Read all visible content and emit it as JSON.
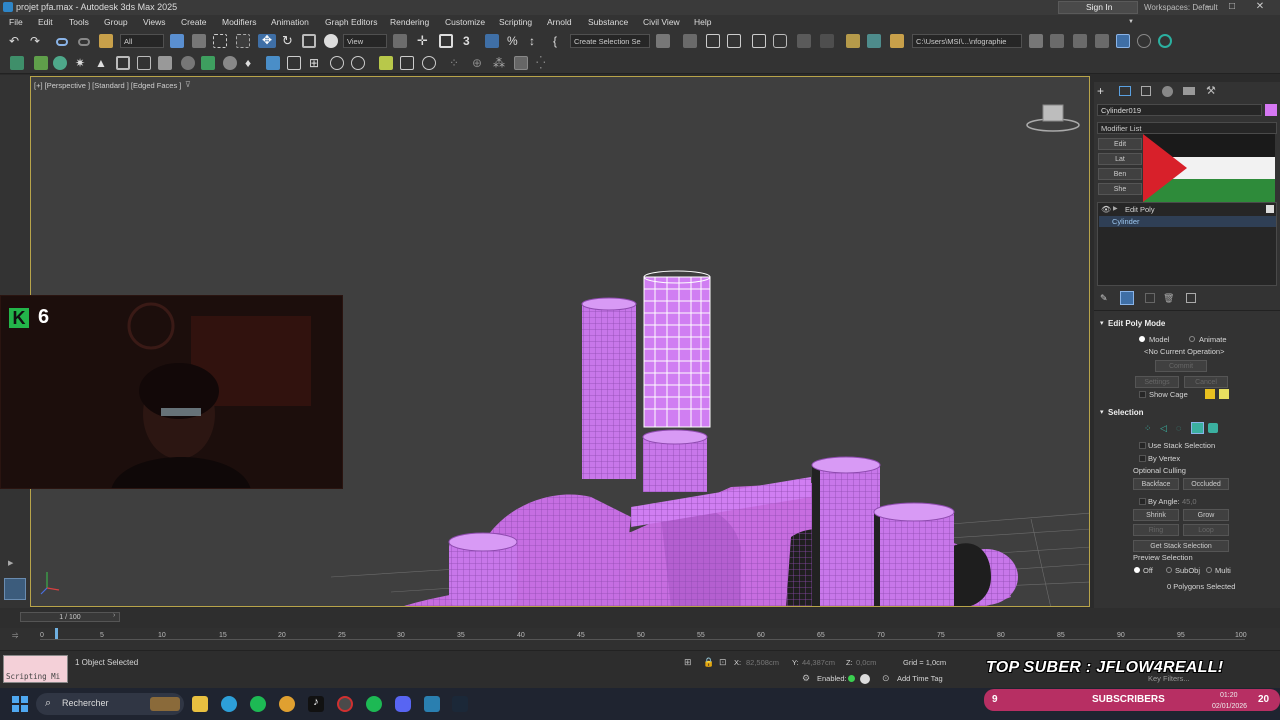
{
  "window": {
    "title": "projet pfa.max - Autodesk 3ds Max 2025",
    "min": "–",
    "max": "□",
    "close": "✕"
  },
  "menu": [
    "File",
    "Edit",
    "Tools",
    "Group",
    "Views",
    "Create",
    "Modifiers",
    "Animation",
    "Graph Editors",
    "Rendering",
    "Customize",
    "Scripting",
    "Arnold",
    "Substance",
    "Civil View",
    "Help"
  ],
  "account": {
    "sign_in": "Sign In",
    "workspaces": "Workspaces: Default"
  },
  "toolbar": {
    "filter_value": "All",
    "refcoord_value": "View",
    "selection_set_placeholder": "Create Selection Se",
    "path_value": "C:\\Users\\MSI\\...\\nfographie"
  },
  "viewport": {
    "label": "[+] [Perspective ] [Standard ] [Edged Faces ]",
    "mesh_color": "#d07ef2",
    "selected_color": "#ffffff"
  },
  "webcam": {
    "badge": "K",
    "value": "6"
  },
  "command_panel": {
    "object_name": "Cylinder019",
    "object_color": "#d678f4",
    "modifier_list": "Modifier List",
    "quick_buttons": [
      "Edit",
      "Lat",
      "Ben",
      "She"
    ],
    "stack": [
      {
        "label": "Edit Poly",
        "selected": false
      },
      {
        "label": "Cylinder",
        "selected": true
      }
    ],
    "edit_poly_mode": {
      "header": "Edit Poly Mode",
      "model": "Model",
      "animate": "Animate",
      "operation": "<No Current Operation>",
      "commit": "Commit",
      "settings": "Settings",
      "cancel": "Cancel",
      "show_cage": "Show Cage"
    },
    "selection": {
      "header": "Selection",
      "use_stack": "Use Stack Selection",
      "by_vertex": "By Vertex",
      "optional_culling": "Optional Culling",
      "backface": "Backface",
      "occluded": "Occluded",
      "by_angle": "By Angle:",
      "angle_value": "45,0",
      "shrink": "Shrink",
      "grow": "Grow",
      "ring": "Ring",
      "loop": "Loop",
      "get_stack": "Get Stack Selection",
      "preview_selection": "Preview Selection",
      "off": "Off",
      "subobj": "SubObj",
      "multi": "Multi",
      "status": "0 Polygons Selected"
    }
  },
  "timeline": {
    "frame_display": "1 / 100",
    "ticks": [
      "0",
      "5",
      "10",
      "15",
      "20",
      "25",
      "30",
      "35",
      "40",
      "45",
      "50",
      "55",
      "60",
      "65",
      "70",
      "75",
      "80",
      "85",
      "90",
      "95",
      "100"
    ]
  },
  "status": {
    "maxscript_label": "Scripting Mi",
    "selected": "1 Object Selected",
    "x_label": "X:",
    "x_value": "82,508cm",
    "y_label": "Y:",
    "y_value": "44,387cm",
    "z_label": "Z:",
    "z_value": "0,0cm",
    "grid": "Grid = 1,0cm",
    "enabled": "Enabled:",
    "add_time_tag": "Add Time Tag",
    "key_filters": "Key Filters..."
  },
  "overlay": {
    "top_suber": "TOP SUBER : JFLOW4REALL!",
    "subscribers_label": "SUBSCRIBERS",
    "subscribers_count": "9",
    "subscribers_goal": "20"
  },
  "taskbar": {
    "search": "Rechercher",
    "time": "01:20",
    "date": "02/01/2026"
  }
}
